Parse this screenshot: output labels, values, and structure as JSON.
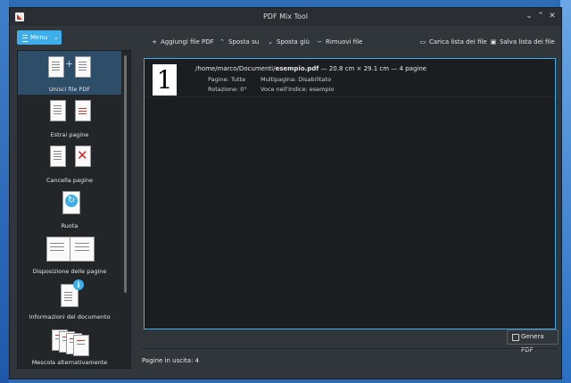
{
  "window": {
    "title": "PDF Mix Tool"
  },
  "menu": {
    "label": "Menu"
  },
  "sidebar": {
    "items": [
      {
        "label": "Unisci file PDF"
      },
      {
        "label": "Estrai pagine"
      },
      {
        "label": "Cancella pagine"
      },
      {
        "label": "Ruota"
      },
      {
        "label": "Disposizione delle pagine"
      },
      {
        "label": "Informazioni del documento"
      },
      {
        "label": "Mescola alternativamente"
      }
    ]
  },
  "toolbar": {
    "add": "Aggiungi file PDF",
    "up": "Sposta su",
    "down": "Sposta giù",
    "remove": "Rimuovi file",
    "load": "Carica lista dei file",
    "save": "Salva lista dei file"
  },
  "file": {
    "thumb_number": "1",
    "path_prefix": "/home/marco/Documenti/",
    "filename": "esempio.pdf",
    "details": " — 20.8 cm × 29.1 cm — 4 pagine",
    "pages": "Pagine: Tutte",
    "multipage": "Multipagina: Disabilitato",
    "rotation": "Rotazione: 0°",
    "index": "Voce nell'indice: esempio"
  },
  "actions": {
    "generate": "Genera PDF"
  },
  "status": {
    "output_pages": "Pagine in uscita: 4"
  }
}
